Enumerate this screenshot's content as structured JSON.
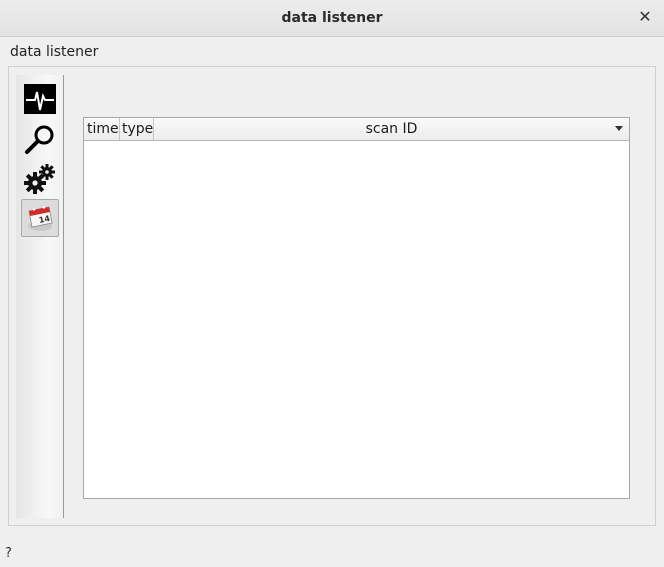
{
  "window": {
    "title": "data listener",
    "close_symbol": "✕"
  },
  "group": {
    "label": "data listener"
  },
  "toolbar": {
    "buttons": [
      {
        "name": "waveform-icon",
        "active": false
      },
      {
        "name": "magnifier-icon",
        "active": false
      },
      {
        "name": "gears-icon",
        "active": false
      },
      {
        "name": "calendar-icon",
        "active": true,
        "day": "14"
      }
    ]
  },
  "table": {
    "columns": [
      "time",
      "type",
      "scan ID"
    ],
    "rows": []
  },
  "status_bar": {
    "help_symbol": "?"
  }
}
